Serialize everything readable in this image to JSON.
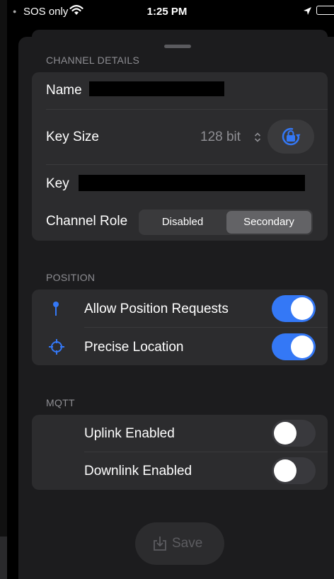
{
  "status_bar": {
    "carrier": "SOS only",
    "time": "1:25 PM"
  },
  "sections": {
    "channel_details": {
      "header": "CHANNEL DETAILS",
      "name_label": "Name",
      "key_size_label": "Key Size",
      "key_size_value": "128 bit",
      "key_label": "Key",
      "channel_role_label": "Channel Role",
      "role_options": [
        "Disabled",
        "Secondary"
      ],
      "role_selected": "Secondary"
    },
    "position": {
      "header": "POSITION",
      "allow_position_requests": {
        "label": "Allow Position Requests",
        "on": true
      },
      "precise_location": {
        "label": "Precise Location",
        "on": true
      }
    },
    "mqtt": {
      "header": "MQTT",
      "uplink": {
        "label": "Uplink Enabled",
        "on": false
      },
      "downlink": {
        "label": "Downlink Enabled",
        "on": false
      }
    }
  },
  "save_label": "Save",
  "colors": {
    "accent": "#3478f6",
    "background": "#1c1c1e",
    "group": "#2c2c2e"
  }
}
